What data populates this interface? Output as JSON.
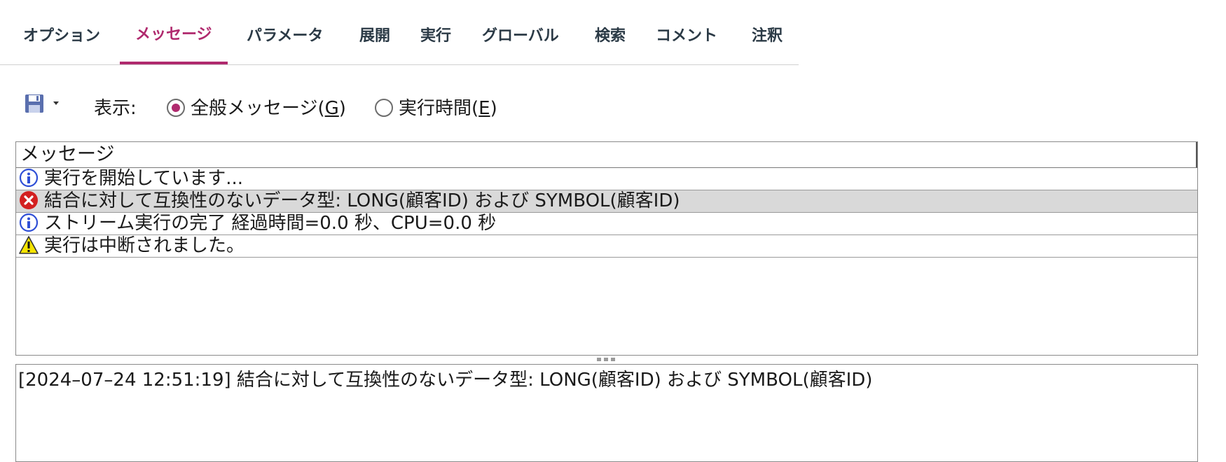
{
  "tabs": [
    {
      "label": "オプション",
      "active": false
    },
    {
      "label": "メッセージ",
      "active": true
    },
    {
      "label": "パラメータ",
      "active": false
    },
    {
      "label": "展開",
      "active": false
    },
    {
      "label": "実行",
      "active": false
    },
    {
      "label": "グローバル",
      "active": false
    },
    {
      "label": "検索",
      "active": false
    },
    {
      "label": "コメント",
      "active": false
    },
    {
      "label": "注釈",
      "active": false
    }
  ],
  "toolbar": {
    "save_icon": "save-icon",
    "show_label": "表示:",
    "radio_general": {
      "label": "全般メッセージ(",
      "mnemonic": "G",
      "suffix": ")",
      "selected": true
    },
    "radio_time": {
      "label": "実行時間(",
      "mnemonic": "E",
      "suffix": ")",
      "selected": false
    }
  },
  "messages": {
    "header": "メッセージ",
    "rows": [
      {
        "type": "info",
        "icon": "info-icon",
        "text": "実行を開始しています..."
      },
      {
        "type": "error",
        "icon": "error-icon",
        "text": "結合に対して互換性のないデータ型: LONG(顧客ID) および SYMBOL(顧客ID)",
        "selected": true
      },
      {
        "type": "info",
        "icon": "info-icon",
        "text": "ストリーム実行の完了 経過時間=0.0 秒、CPU=0.0 秒"
      },
      {
        "type": "warning",
        "icon": "warning-icon",
        "text": "実行は中断されました。"
      }
    ]
  },
  "detail": {
    "text": "[2024–07–24 12:51:19] 結合に対して互換性のないデータ型: LONG(顧客ID) および SYMBOL(顧客ID)"
  },
  "colors": {
    "accent": "#b02a6e",
    "tab_text": "#2b3a46",
    "selected_row": "#d9d9d9"
  }
}
